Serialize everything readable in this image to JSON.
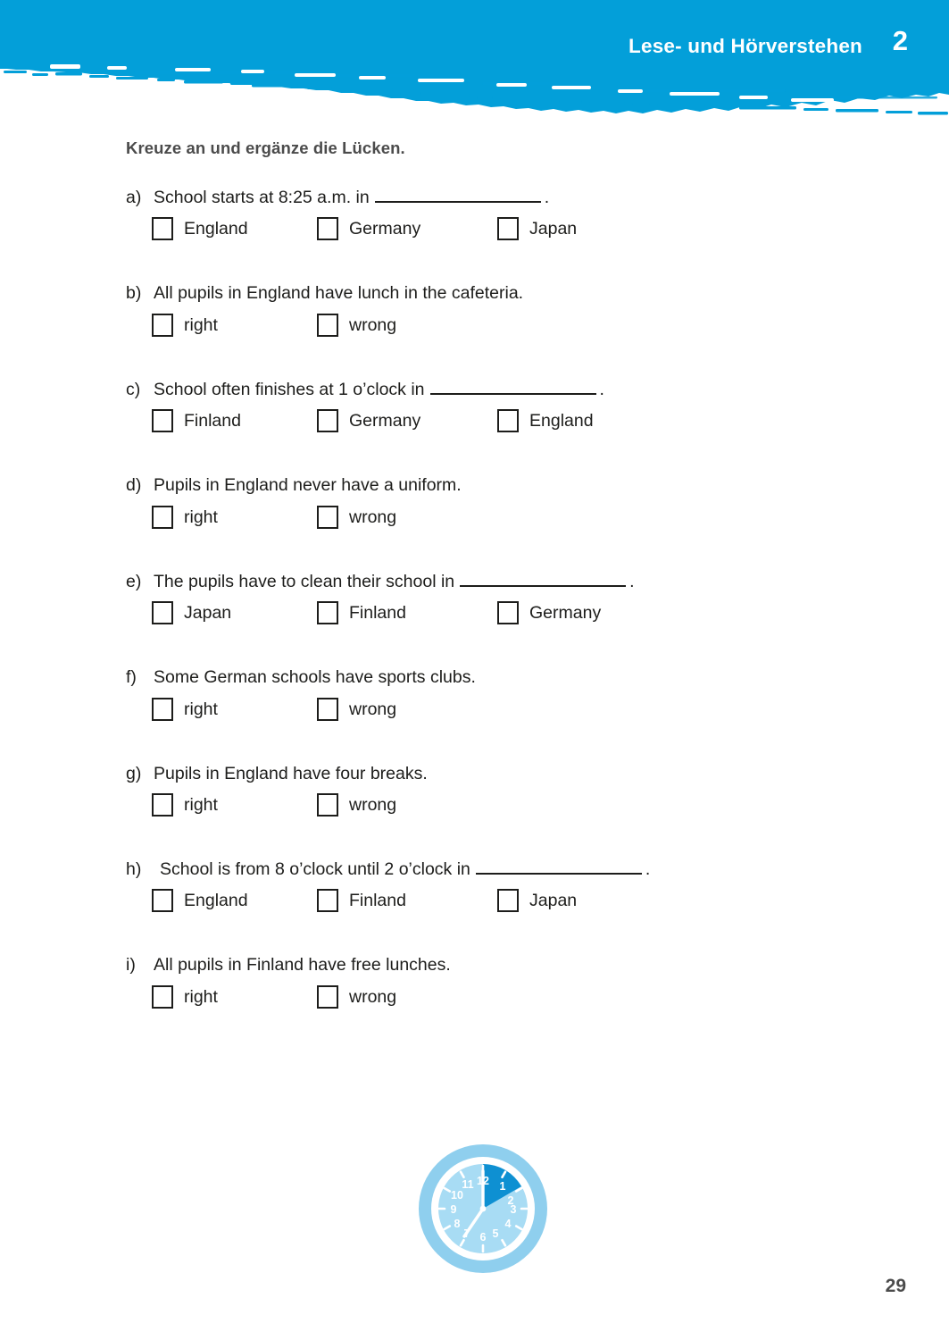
{
  "header": {
    "title": "Lese- und Hörverstehen",
    "chapter_number": "2",
    "background_color": "#039FD9",
    "text_color": "#FFFFFF"
  },
  "instruction": "Kreuze an und ergänze die Lücken.",
  "blank_placeholder": "",
  "exercises": [
    {
      "letter": "a)",
      "question_before": "School starts at 8:25 a.m. in",
      "has_blank": true,
      "question_after": ".",
      "options": [
        "England",
        "Germany",
        "Japan"
      ]
    },
    {
      "letter": "b)",
      "question_before": "All pupils in England have lunch in the cafeteria.",
      "has_blank": false,
      "question_after": "",
      "options": [
        "right",
        "wrong"
      ]
    },
    {
      "letter": "c)",
      "question_before": "School often finishes at 1 o’clock in",
      "has_blank": true,
      "question_after": ".",
      "options": [
        "Finland",
        "Germany",
        "England"
      ]
    },
    {
      "letter": "d)",
      "question_before": "Pupils in England never have a uniform.",
      "has_blank": false,
      "question_after": "",
      "options": [
        "right",
        "wrong"
      ]
    },
    {
      "letter": "e)",
      "question_before": "The pupils have to clean their school in",
      "has_blank": true,
      "question_after": ".",
      "options": [
        "Japan",
        "Finland",
        "Germany"
      ]
    },
    {
      "letter": "f)",
      "question_before": "Some German schools have sports clubs.",
      "has_blank": false,
      "question_after": "",
      "options": [
        "right",
        "wrong"
      ]
    },
    {
      "letter": "g)",
      "question_before": "Pupils in England have four breaks.",
      "has_blank": false,
      "question_after": "",
      "options": [
        "right",
        "wrong"
      ]
    },
    {
      "letter": "h)",
      "question_before": "School is from 8 o’clock until 2 o’clock in",
      "has_blank": true,
      "question_after": ".",
      "options": [
        "England",
        "Finland",
        "Japan"
      ]
    },
    {
      "letter": "i)",
      "question_before": "All pupils in Finland have free lunches.",
      "has_blank": false,
      "question_after": "",
      "options": [
        "right",
        "wrong"
      ]
    }
  ],
  "illustration": {
    "name": "clock-illustration",
    "outer_ring_color": "#8FCFEE",
    "rim_color": "#FFFFFF",
    "face_color": "#A8DCF4",
    "wedge_color": "#0E90D2",
    "hand_color": "#FFFFFF",
    "numerals": [
      "12",
      "1",
      "2",
      "3",
      "4",
      "5",
      "6",
      "7",
      "8",
      "9",
      "10",
      "11"
    ],
    "hour_hand_points_to": "7",
    "minute_hand_points_to": "12"
  },
  "page_number": "29"
}
